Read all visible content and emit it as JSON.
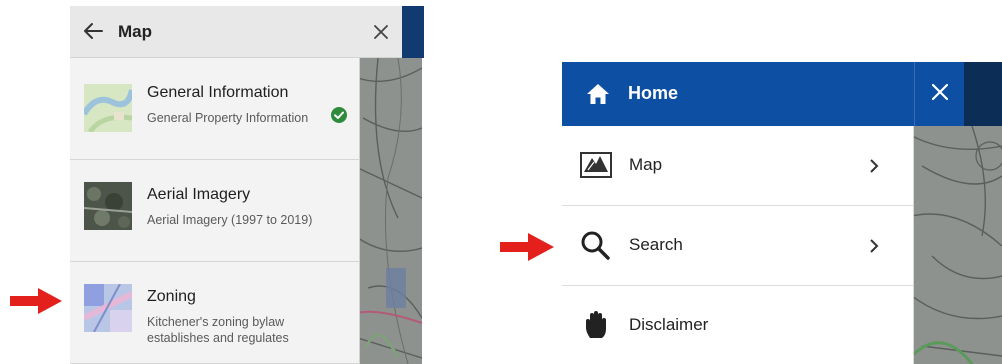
{
  "left_panel": {
    "header": {
      "title": "Map",
      "back_icon": "arrow-left-icon",
      "close_icon": "close-icon"
    },
    "items": [
      {
        "title": "General Information",
        "description": "General Property Information",
        "status_icon": "check-circle-icon",
        "status_color": "#2e8b3c"
      },
      {
        "title": "Aerial Imagery",
        "description": "Aerial Imagery (1997 to 2019)"
      },
      {
        "title": "Zoning",
        "description": "Kitchener's zoning bylaw establishes and regulates"
      }
    ]
  },
  "right_panel": {
    "header": {
      "title": "Home",
      "icon": "home-icon",
      "close_icon": "close-icon",
      "color": "#0d4fa2"
    },
    "items": [
      {
        "label": "Map",
        "icon": "map-icon",
        "chevron": "chevron-right-icon"
      },
      {
        "label": "Search",
        "icon": "search-icon",
        "chevron": "chevron-right-icon"
      },
      {
        "label": "Disclaimer",
        "icon": "hand-icon"
      }
    ]
  },
  "annotation_color": "#e3201b"
}
